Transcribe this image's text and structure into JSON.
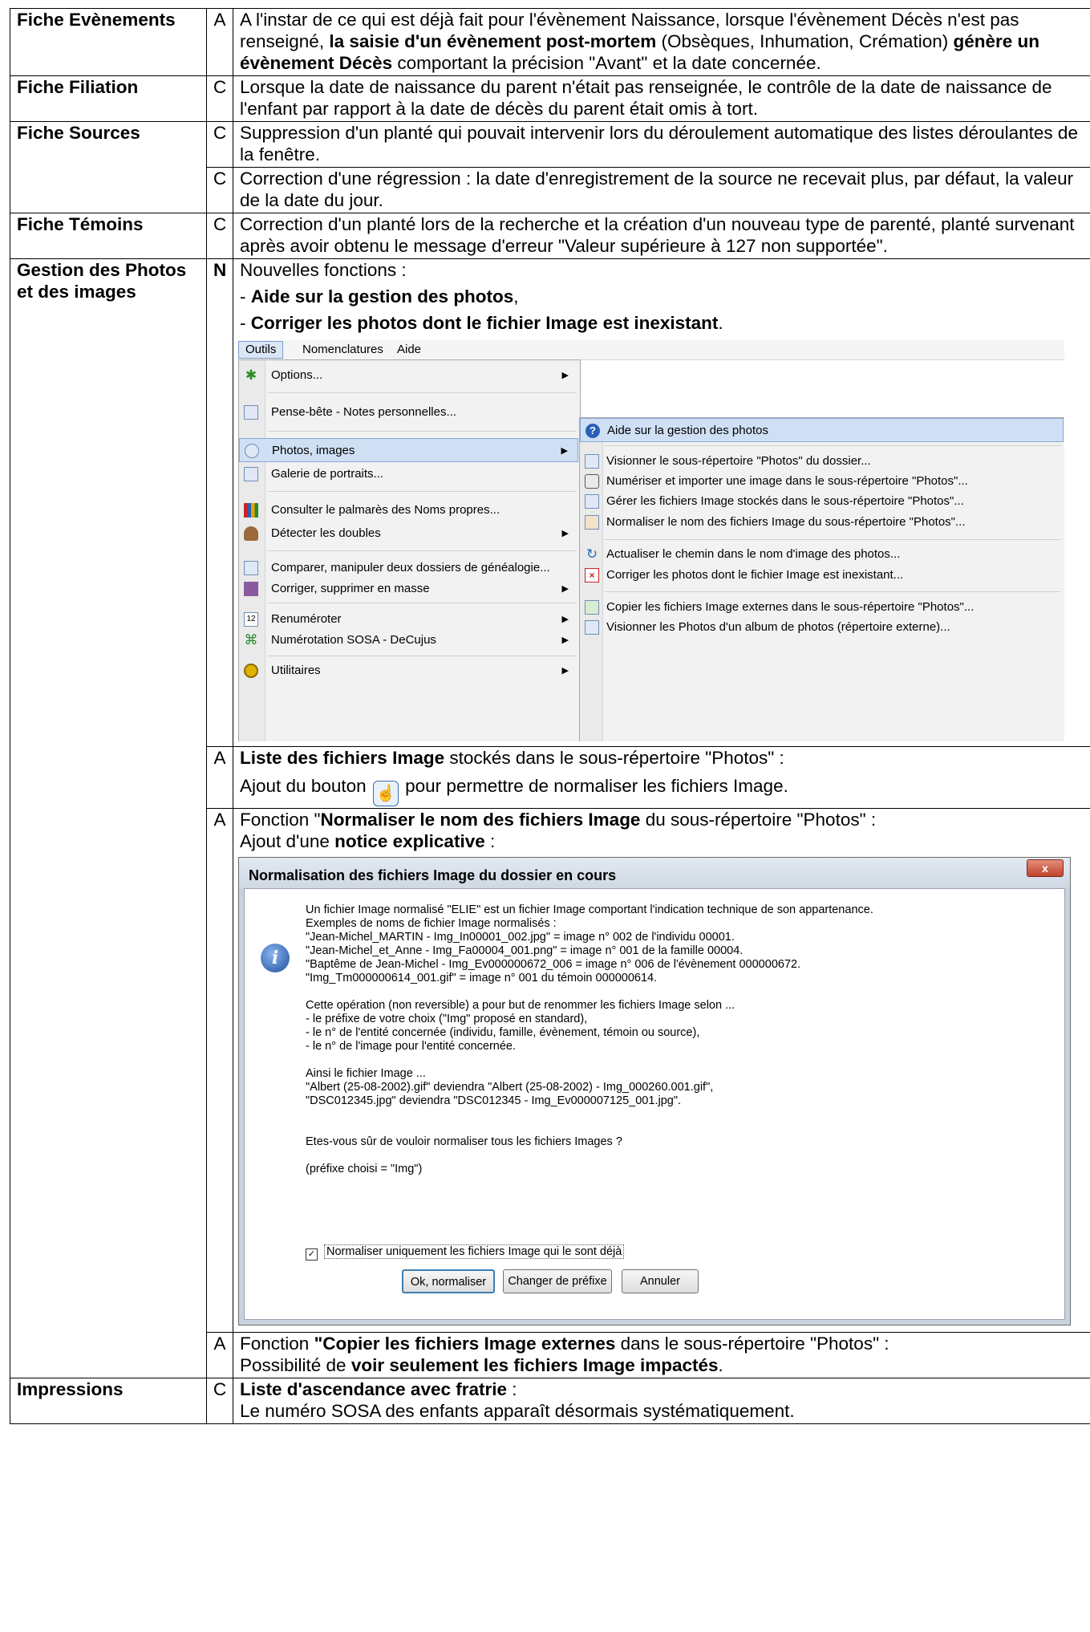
{
  "rows": {
    "evenements": {
      "category": "Fiche Evènements",
      "type": "A",
      "text": {
        "p1": "A l'instar de ce qui est déjà fait pour l'évènement Naissance, lorsque l'évènement Décès n'est pas renseigné, ",
        "b1": "la saisie d'un évènement post-mortem",
        "p2": " (Obsèques, Inhumation, Crémation) ",
        "b2": "génère un évènement Décès",
        "p3": " comportant la précision \"Avant\" et la date concernée."
      }
    },
    "filiation": {
      "category": "Fiche Filiation",
      "type": "C",
      "text": "Lorsque la date de naissance du parent n'était pas renseignée, le contrôle de la date de naissance de l'enfant par rapport à la date de décès du parent était omis à tort."
    },
    "sources": {
      "category": "Fiche Sources",
      "type1": "C",
      "text1": "Suppression d'un planté qui pouvait intervenir lors du déroulement automatique des listes déroulantes de la fenêtre.",
      "type2": "C",
      "text2": "Correction d'une régression : la date d'enregistrement de la source ne recevait plus, par défaut, la valeur de la date du jour."
    },
    "temoins": {
      "category": "Fiche Témoins",
      "type": "C",
      "text": "Correction d'un planté lors de la recherche et la création d'un nouveau type de parenté, planté survenant après avoir obtenu le message d'erreur \"Valeur supérieure à 127 non supportée\"."
    },
    "photos": {
      "category": "Gestion des Photos et des images",
      "type1": "N",
      "intro": "Nouvelles fonctions :",
      "bullet1_prefix": "- ",
      "bullet1_bold": "Aide sur la gestion des photos",
      "bullet1_suffix": ",",
      "bullet2_prefix": "- ",
      "bullet2_bold": "Corriger les photos dont le fichier Image est inexistant",
      "bullet2_suffix": ".",
      "type2": "A",
      "liste_bold": "Liste des fichiers Image",
      "liste_rest": " stockés dans le sous-répertoire \"Photos\" :",
      "ajout_prefix": "Ajout du bouton ",
      "ajout_suffix": " pour permettre de normaliser les fichiers Image.",
      "type3": "A",
      "fonction_prefix": "Fonction \"",
      "fonction_bold": "Normaliser le  nom des fichiers Image",
      "fonction_rest": " du sous-répertoire \"Photos\" :",
      "notice_prefix": "Ajout d'une ",
      "notice_bold": "notice explicative",
      "notice_suffix": " :",
      "type4": "A",
      "copier_prefix": "Fonction ",
      "copier_bold": "\"Copier les fichiers Image externes",
      "copier_rest": " dans le sous-répertoire \"Photos\" :",
      "voir_prefix": "Possibilité de ",
      "voir_bold": "voir seulement les fichiers Image impactés",
      "voir_suffix": "."
    },
    "impressions": {
      "category": "Impressions",
      "type": "C",
      "title_bold": "Liste d'ascendance avec fratrie",
      "title_suffix": " :",
      "text": "Le numéro SOSA des enfants apparaît désormais systématiquement."
    }
  },
  "menu": {
    "bar": [
      "Outils",
      "Nomenclatures",
      "Aide"
    ],
    "left_items": [
      {
        "label": "Options...",
        "icon": "options-icon"
      },
      {
        "label": "Pense-bête - Notes personnelles...",
        "icon": "notes-icon"
      },
      {
        "label": "Photos, images",
        "icon": "camera-icon"
      },
      {
        "label": "Galerie de portraits...",
        "icon": "gallery-icon"
      },
      {
        "label": "Consulter le palmarès des Noms propres...",
        "icon": "bar-chart-icon"
      },
      {
        "label": "Détecter les doubles",
        "icon": "duplicates-icon"
      },
      {
        "label": "Comparer, manipuler deux dossiers de généalogie...",
        "icon": "compare-icon"
      },
      {
        "label": "Corriger, supprimer en masse",
        "icon": "mass-edit-icon"
      },
      {
        "label": "Renuméroter",
        "icon": "renumber-icon"
      },
      {
        "label": "Numérotation SOSA  -  DeCujus",
        "icon": "sosa-icon"
      },
      {
        "label": "Utilitaires",
        "icon": "utilities-icon"
      }
    ],
    "right_items": [
      {
        "label": "Aide sur la gestion des photos",
        "icon": "help-icon"
      },
      {
        "label": "Visionner le sous-répertoire \"Photos\" du dossier...",
        "icon": "view-folder-icon"
      },
      {
        "label": "Numériser et importer une image dans le sous-répertoire \"Photos\"...",
        "icon": "scanner-icon"
      },
      {
        "label": "Gérer les fichiers Image stockés dans le sous-répertoire \"Photos\"...",
        "icon": "list-icon"
      },
      {
        "label": "Normaliser le nom des fichiers Image du sous-répertoire \"Photos\"...",
        "icon": "normalize-icon"
      },
      {
        "label": "Actualiser le chemin dans le nom d'image des photos...",
        "icon": "refresh-icon"
      },
      {
        "label": "Corriger les photos dont le fichier Image est inexistant...",
        "icon": "delete-icon"
      },
      {
        "label": "Copier les fichiers Image externes dans le sous-répertoire \"Photos\"...",
        "icon": "copy-icon"
      },
      {
        "label": "Visionner les Photos d'un album de photos (répertoire externe)...",
        "icon": "album-icon"
      }
    ]
  },
  "dialog": {
    "title": "Normalisation des fichiers Image du dossier en cours",
    "close": "x",
    "lines": [
      "Un fichier Image normalisé \"ELIE\" est un fichier Image comportant l'indication technique de son appartenance.",
      "Exemples de noms de fichier Image normalisés :",
      "\"Jean-Michel_MARTIN - Img_In00001_002.jpg\" = image n° 002 de l'individu 00001.",
      "\"Jean-Michel_et_Anne - Img_Fa00004_001.png\" = image n° 001 de la famille 00004.",
      "\"Baptême de Jean-Michel - Img_Ev000000672_006 = image n° 006 de l'évènement 000000672.",
      "\"Img_Tm000000614_001.gif\" = image n° 001 du témoin 000000614.",
      "",
      "Cette opération (non reversible) a pour but de renommer les fichiers Image selon ...",
      "- le préfixe de votre choix (\"Img\" proposé en standard),",
      "- le n° de l'entité concernée (individu, famille, évènement, témoin ou source),",
      "- le n° de l'image pour l'entité concernée.",
      "",
      "Ainsi le fichier Image ...",
      "\"Albert (25-08-2002).gif\" deviendra \"Albert (25-08-2002) - Img_000260.001.gif\",",
      "\"DSC012345.jpg\" deviendra \"DSC012345 - Img_Ev000007125_001.jpg\".",
      "",
      "",
      "Etes-vous sûr de vouloir normaliser tous les fichiers Images ?",
      "",
      "(préfixe choisi = \"Img\")"
    ],
    "checkbox_mark": "✓",
    "checkbox_label": "Normaliser uniquement les fichiers Image qui le sont déjà",
    "btn_ok": "Ok, normaliser",
    "btn_prefix": "Changer de préfixe",
    "btn_cancel": "Annuler"
  }
}
